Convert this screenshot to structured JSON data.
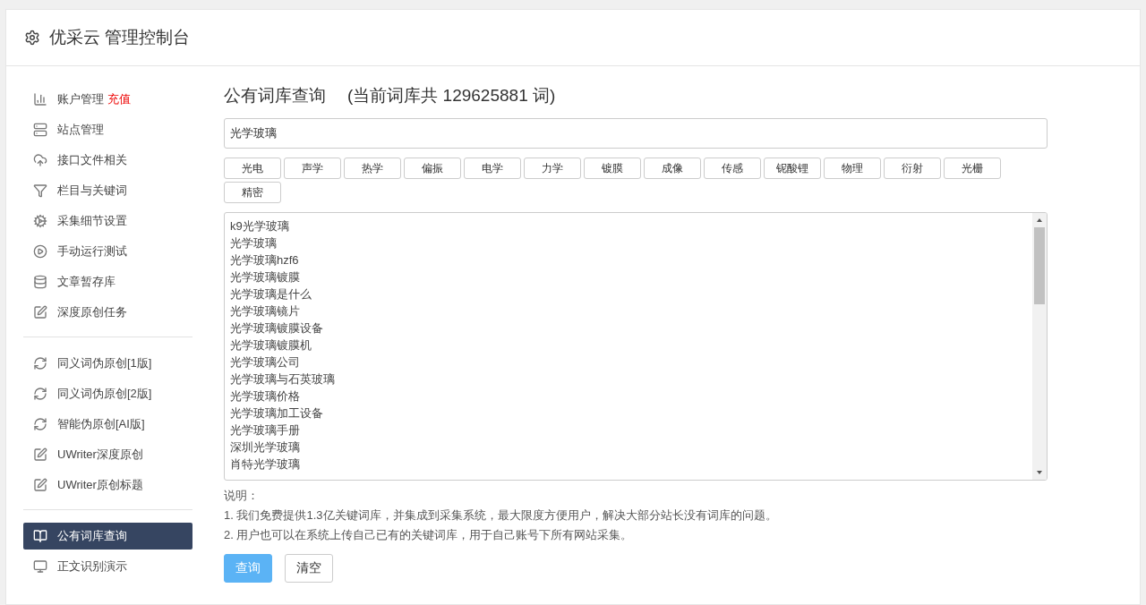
{
  "header": {
    "title": "优采云 管理控制台"
  },
  "sidebar": {
    "sections": [
      {
        "items": [
          {
            "label": "账户管理",
            "badge": "充值",
            "selected": false
          },
          {
            "label": "站点管理",
            "selected": false
          },
          {
            "label": "接口文件相关",
            "selected": false
          },
          {
            "label": "栏目与关键词",
            "selected": false
          },
          {
            "label": "采集细节设置",
            "selected": false
          },
          {
            "label": "手动运行测试",
            "selected": false
          },
          {
            "label": "文章暂存库",
            "selected": false
          },
          {
            "label": "深度原创任务",
            "selected": false
          }
        ]
      },
      {
        "items": [
          {
            "label": "同义词伪原创[1版]",
            "selected": false
          },
          {
            "label": "同义词伪原创[2版]",
            "selected": false
          },
          {
            "label": "智能伪原创[AI版]",
            "selected": false
          },
          {
            "label": "UWriter深度原创",
            "selected": false
          },
          {
            "label": "UWriter原创标题",
            "selected": false
          }
        ]
      },
      {
        "items": [
          {
            "label": "公有词库查询",
            "selected": true
          },
          {
            "label": "正文识别演示",
            "selected": false
          }
        ]
      }
    ]
  },
  "main": {
    "title": "公有词库查询",
    "count_note": "(当前词库共 129625881 词)",
    "search": {
      "value": "光学玻璃"
    },
    "tags": [
      "光电",
      "声学",
      "热学",
      "偏振",
      "电学",
      "力学",
      "镀膜",
      "成像",
      "传感",
      "铌酸锂",
      "物理",
      "衍射",
      "光栅",
      "精密"
    ],
    "results": [
      "k9光学玻璃",
      "光学玻璃",
      "光学玻璃hzf6",
      "光学玻璃镀膜",
      "光学玻璃是什么",
      "光学玻璃镜片",
      "光学玻璃镀膜设备",
      "光学玻璃镀膜机",
      "光学玻璃公司",
      "光学玻璃与石英玻璃",
      "光学玻璃价格",
      "光学玻璃加工设备",
      "光学玻璃手册",
      "深圳光学玻璃",
      "肖特光学玻璃"
    ],
    "notes_title": "说明：",
    "notes": [
      "1. 我们免费提供1.3亿关键词库，并集成到采集系统，最大限度方便用户，解决大部分站长没有词库的问题。",
      "2. 用户也可以在系统上传自己已有的关键词库，用于自己账号下所有网站采集。"
    ],
    "buttons": [
      {
        "label": "查询",
        "kind": "primary"
      },
      {
        "label": "清空",
        "kind": "default"
      }
    ]
  }
}
